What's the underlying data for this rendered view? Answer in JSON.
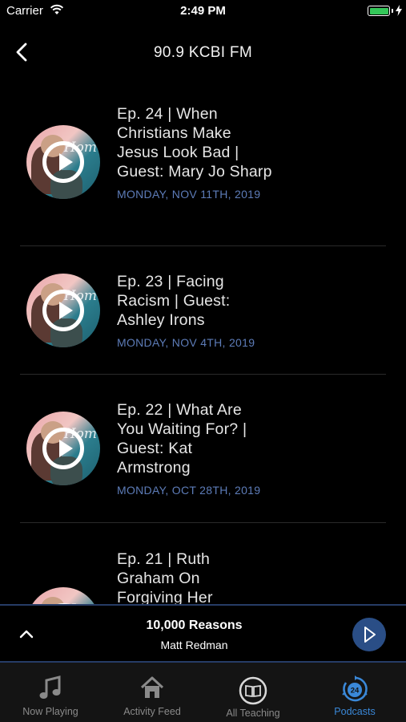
{
  "status_bar": {
    "carrier": "Carrier",
    "time": "2:49 PM",
    "battery_level": 1.0
  },
  "nav": {
    "title": "90.9 KCBI FM",
    "back_icon": "chevron-left-icon"
  },
  "episodes": [
    {
      "title": "Ep. 24 | When Christians Make Jesus Look Bad | Guest: Mary Jo Sharp",
      "date": "MONDAY, NOV 11TH, 2019"
    },
    {
      "title": "Ep. 23 | Facing Racism | Guest: Ashley Irons",
      "date": "MONDAY, NOV 4TH, 2019"
    },
    {
      "title": "Ep. 22 | What Are You Waiting For? | Guest: Kat Armstrong",
      "date": "MONDAY, OCT 28TH, 2019"
    },
    {
      "title": "Ep. 21 | Ruth Graham On Forgiving Her",
      "date": ""
    }
  ],
  "mini_player": {
    "song": "10,000 Reasons",
    "artist": "Matt Redman"
  },
  "tabs": [
    {
      "label": "Now Playing",
      "icon": "music-note-icon",
      "active": false
    },
    {
      "label": "Activity Feed",
      "icon": "home-icon",
      "active": false
    },
    {
      "label": "All Teaching",
      "icon": "book-icon",
      "active": false
    },
    {
      "label": "Podcasts",
      "icon": "podcast-24-icon",
      "active": true
    }
  ],
  "colors": {
    "accent": "#3a88d8",
    "date_text": "#5d7cb8",
    "player_border": "#263c66",
    "player_button": "#2a4e86",
    "battery": "#34c759"
  }
}
